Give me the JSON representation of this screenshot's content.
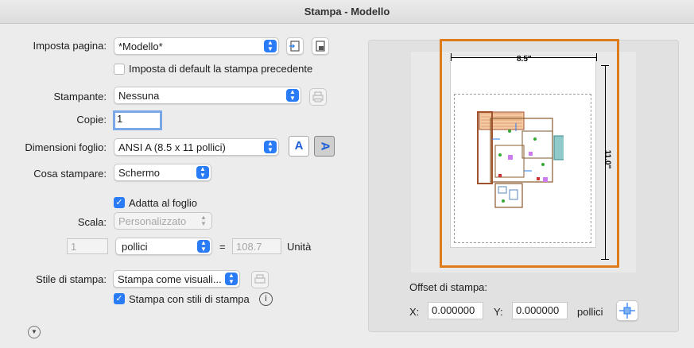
{
  "window": {
    "title": "Stampa - Modello"
  },
  "page_setup": {
    "label": "Imposta pagina:",
    "value": "*Modello*"
  },
  "default_checkbox": {
    "label": "Imposta di default la stampa precedente",
    "checked": false
  },
  "printer": {
    "label": "Stampante:",
    "value": "Nessuna"
  },
  "copies": {
    "label": "Copie:",
    "value": "1"
  },
  "paper_size": {
    "label": "Dimensioni foglio:",
    "value": "ANSI A (8.5 x 11 pollici)"
  },
  "what_to_print": {
    "label": "Cosa stampare:",
    "value": "Schermo"
  },
  "fit_to_paper": {
    "label": "Adatta al foglio",
    "checked": true
  },
  "scale": {
    "label": "Scala:",
    "value": "Personalizzato",
    "left_value": "1",
    "units": "pollici",
    "equals": "=",
    "right_value": "108.7",
    "unit_label": "Unità"
  },
  "plot_style": {
    "label": "Stile di stampa:",
    "value": "Stampa come visuali..."
  },
  "plot_with_styles": {
    "label": "Stampa con stili di stampa",
    "checked": true,
    "info": "i"
  },
  "preview": {
    "width_label": "8.5\"",
    "height_label": "11.0\""
  },
  "offset": {
    "title": "Offset di stampa:",
    "x_label": "X:",
    "x_value": "0.000000",
    "y_label": "Y:",
    "y_value": "0.000000",
    "units": "pollici"
  },
  "orientation": {
    "portrait_glyph": "A",
    "landscape_glyph": "A",
    "selected": "landscape"
  },
  "disclosure": {
    "glyph": "▼"
  },
  "colors": {
    "accent": "#2a7cf6",
    "preview_frame": "#e07b1a"
  }
}
